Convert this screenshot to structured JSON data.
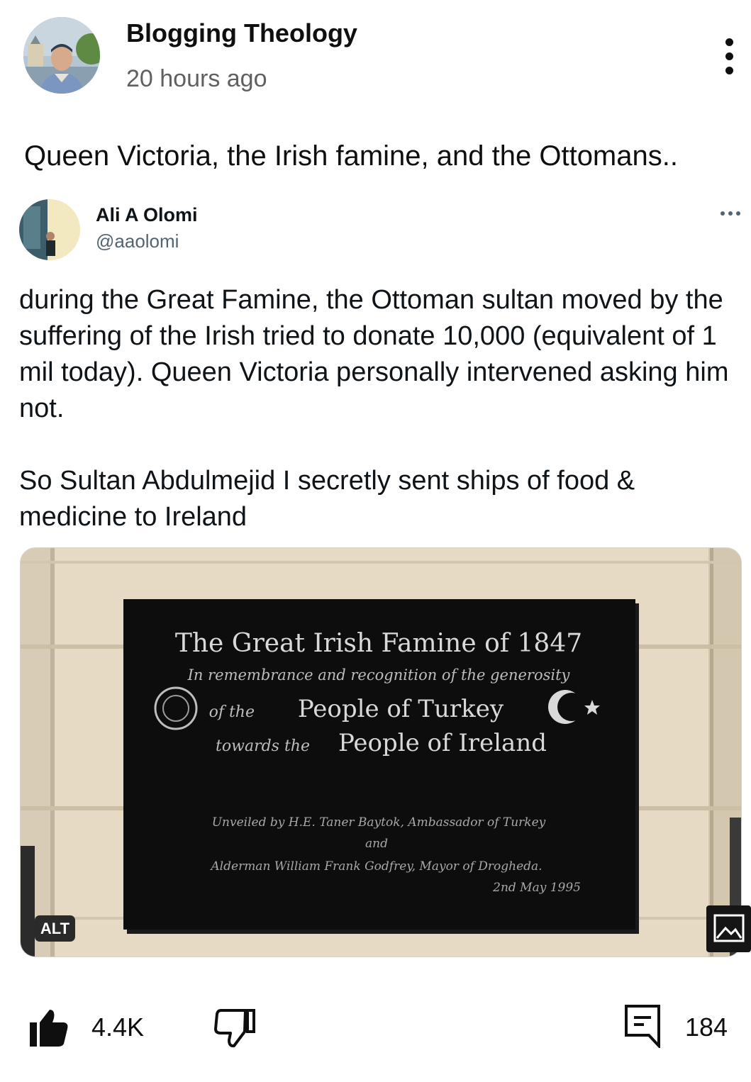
{
  "post": {
    "channel_name": "Blogging Theology",
    "time": "20 hours ago",
    "text": "Queen Victoria, the Irish famine, and the Ottomans.."
  },
  "tweet": {
    "author_name": "Ali A Olomi",
    "handle": "@aaolomi",
    "paragraph_1": "during the Great Famine, the Ottoman sultan moved by the suffering of the Irish tried to donate 10,000 (equivalent of 1 mil today). Queen Victoria personally intervened asking him not.",
    "paragraph_2": "So Sultan Abdulmejid I secretly sent ships of food & medicine to Ireland",
    "image": {
      "alt_badge": "ALT",
      "plaque_title": "The Great Irish Famine of 1847",
      "plaque_line_1": "In remembrance and recognition of the generosity",
      "plaque_of_the": "of the",
      "plaque_people_turkey": "People of Turkey",
      "plaque_towards_the": "towards the",
      "plaque_people_ireland": "People of Ireland",
      "plaque_unveiled": "Unveiled by H.E. Taner Baytok, Ambassador of Turkey",
      "plaque_and": "and",
      "plaque_alderman": "Alderman William Frank Godfrey, Mayor of Drogheda.",
      "plaque_date": "2nd May 1995"
    }
  },
  "actions": {
    "like_count": "4.4K",
    "comment_count": "184"
  },
  "icons": {
    "menu": "more-vert-icon",
    "tweet_menu": "more-horiz-icon",
    "like": "thumbs-up-filled-icon",
    "dislike": "thumbs-down-outline-icon",
    "comment": "comment-icon",
    "image": "image-icon"
  }
}
